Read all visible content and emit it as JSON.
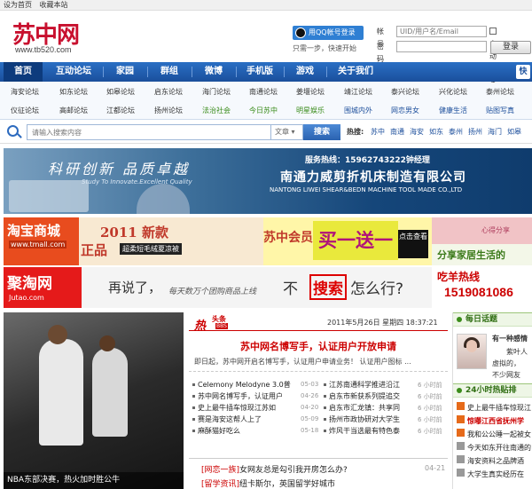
{
  "util": {
    "set_home": "设为首页",
    "favorite": "收藏本站"
  },
  "header": {
    "logo": "苏中网",
    "url": "www.tb520.com",
    "qq_login": "用QQ帐号登录",
    "qq_note": "只需一步，快速开始",
    "account_label": "帐号",
    "account_placeholder": "UID/用户名/Email",
    "auto_login": "自动登录",
    "password_label": "密码",
    "login_button": "登录"
  },
  "nav": {
    "items": [
      "首页",
      "互动论坛",
      "家园",
      "群组",
      "微博",
      "手机版",
      "游戏",
      "关于我们"
    ],
    "quick": "快"
  },
  "sublinks": {
    "row1": [
      "海安论坛",
      "如东论坛",
      "如皋论坛",
      "启东论坛",
      "海门论坛",
      "南通论坛",
      "姜堰论坛",
      "靖江论坛",
      "泰兴论坛",
      "兴化论坛",
      "泰州论坛"
    ],
    "row2": [
      "仪征论坛",
      "高邮论坛",
      "江都论坛",
      "扬州论坛",
      "法治社会",
      "今日苏中",
      "明星娱乐",
      "围城内外",
      "网恋男女",
      "健康生活",
      "贴图写真"
    ]
  },
  "search": {
    "placeholder": "请输入搜索内容",
    "type": "文章",
    "button": "搜索",
    "hot_label": "热搜:",
    "hot": [
      "苏中",
      "南通",
      "海安",
      "如东",
      "泰州",
      "扬州",
      "海门",
      "如皋"
    ]
  },
  "banner1": {
    "slogan": "科研创新  品质卓越",
    "slogan_en": "Study To Innovate.Excellent Quality",
    "hotline": "服务热线：15962743222钟经理",
    "company": "南通力威剪折机床制造有限公司",
    "company_en": "NANTONG LIWEI SHEAR&BEDN MACHINE TOOL MADE CO.,LTD"
  },
  "ads1": {
    "taobao": "淘宝商城",
    "taobao_url": "www.tmall.com",
    "new_year": "2011 新款",
    "genuine": "正品",
    "new_sub": "超柔短毛绒夏凉被",
    "member": "苏中会员",
    "buy_one": "买一送一",
    "click": "点击查看",
    "share_top": "心得分享",
    "share": "分享家居生活的"
  },
  "ads2": {
    "jutao": "聚淘网",
    "jutao_url": "Jutao.com",
    "q1": "再说了，",
    "q2": "每天数万个团购商品上线",
    "q3": "不",
    "q4": "搜索",
    "q5": "怎么行?",
    "sheep": "吃羊热线",
    "sheep_phone": "1519081086"
  },
  "photo": {
    "caption": "NBA东部决赛，热火加时胜公牛"
  },
  "headline": {
    "logo": "热",
    "logo2": "头条",
    "bbs": "BBS",
    "date": "2011年5月26日 星期四 18:37:21",
    "title": "苏中网名博写手，认证用户开放申请",
    "summary": "即日起，苏中网开启名博写手，认证用户申请业务！ 认证用户图标 ...",
    "left_news": [
      {
        "t": "Celemony Melodyne 3.0普",
        "d": "05-03"
      },
      {
        "t": "苏中网名博写手，认证用户",
        "d": "04-26"
      },
      {
        "t": "史上最牛插车惊现江苏如",
        "d": "04-20"
      },
      {
        "t": "赛是海安这帮人上了",
        "d": "05-09"
      },
      {
        "t": "麻酥猫好吃么",
        "d": "05-18"
      }
    ],
    "right_news": [
      {
        "t": "江苏南通科学推进沿江",
        "d": "6 小时前"
      },
      {
        "t": "启东市新获系列提追交",
        "d": "6 小时前"
      },
      {
        "t": "启东市汇龙镇：共享同",
        "d": "6 小时前"
      },
      {
        "t": "扬州市政协研对大学生",
        "d": "6 小时前"
      },
      {
        "t": "炸风干当选最有特色泰",
        "d": "6 小时前"
      }
    ],
    "bottom": [
      {
        "tag": "[网恋一族]",
        "t": "女网友总是勾引我开房怎么办?",
        "d": "04-21"
      },
      {
        "tag": "[留学资讯]",
        "t": "纽卡斯尔，英国留学好城市",
        "d": ""
      }
    ]
  },
  "right": {
    "daily_title": "每日话题",
    "daily_headline": "有一种感情",
    "daily_text1": "紫叶人",
    "daily_text2": "虚拟的，",
    "daily_text3": "不少网友",
    "hot_title": "24小时热贴排",
    "hot_items": [
      "史上最牛插车惊现江",
      "惊曝江西省抚州学",
      "我和公公睡一起被女",
      "今天如东开往南通的",
      "海安资料之品牌酒",
      "大学生真实经历在"
    ]
  },
  "colors": {
    "brand_red": "#c8102e",
    "nav_blue": "#1a4f9c",
    "green": "#3a8c1a"
  }
}
